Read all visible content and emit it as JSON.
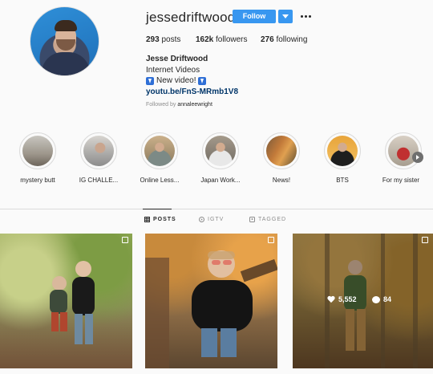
{
  "profile": {
    "username": "jessedriftwood",
    "follow_label": "Follow",
    "posts_count": "293",
    "posts_label": "posts",
    "followers_count": "162k",
    "followers_label": "followers",
    "following_count": "276",
    "following_label": "following",
    "full_name": "Jesse Driftwood",
    "category": "Internet Videos",
    "bio_text": "New video!",
    "link": "youtu.be/FnS-MRmb1V8",
    "followed_by_prefix": "Followed by",
    "followed_by_user": "annaleewright",
    "accent_color": "#3897f0"
  },
  "highlights": [
    {
      "label": "mystery butt"
    },
    {
      "label": "IG CHALLE..."
    },
    {
      "label": "Online Less..."
    },
    {
      "label": "Japan Work..."
    },
    {
      "label": "News!"
    },
    {
      "label": "BTS"
    },
    {
      "label": "For my sister"
    }
  ],
  "tabs": [
    {
      "label": "POSTS",
      "icon": "grid-icon",
      "active": true
    },
    {
      "label": "IGTV",
      "icon": "igtv-icon",
      "active": false
    },
    {
      "label": "TAGGED",
      "icon": "tag-icon",
      "active": false
    }
  ],
  "posts": [
    {
      "id": "post-1",
      "multi": true
    },
    {
      "id": "post-2",
      "multi": true
    },
    {
      "id": "post-3",
      "multi": true,
      "likes": "5,552",
      "comments": "84"
    }
  ]
}
